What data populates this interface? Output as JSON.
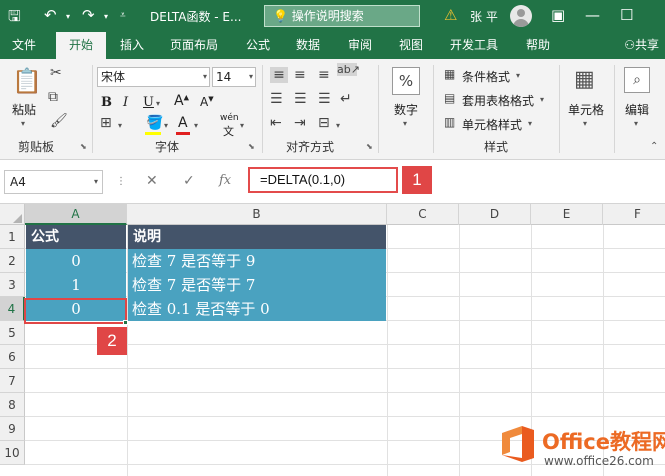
{
  "titlebar": {
    "doc_title": "DELTA函数 - E...",
    "tell_me": "操作说明搜索",
    "user_name": "张 平"
  },
  "tabs": [
    {
      "label": "文件",
      "active": false
    },
    {
      "label": "开始",
      "active": true
    },
    {
      "label": "插入",
      "active": false
    },
    {
      "label": "页面布局",
      "active": false
    },
    {
      "label": "公式",
      "active": false
    },
    {
      "label": "数据",
      "active": false
    },
    {
      "label": "审阅",
      "active": false
    },
    {
      "label": "视图",
      "active": false
    },
    {
      "label": "开发工具",
      "active": false
    },
    {
      "label": "帮助",
      "active": false
    }
  ],
  "share_label": "共享",
  "ribbon": {
    "clipboard": {
      "paste": "粘贴",
      "group": "剪贴板"
    },
    "font": {
      "name": "宋体",
      "size": "14",
      "phonetic": "wén",
      "group": "字体"
    },
    "alignment": {
      "group": "对齐方式"
    },
    "number": {
      "label": "数字",
      "icon_text": "%"
    },
    "styles": {
      "conditional": "条件格式",
      "table": "套用表格格式",
      "cell_styles": "单元格样式",
      "group": "样式"
    },
    "cells": {
      "label": "单元格"
    },
    "editing": {
      "label": "编辑"
    }
  },
  "formula_bar": {
    "name_box": "A4",
    "fx": "fx",
    "formula": "=DELTA(0.1,0)",
    "callout": "1"
  },
  "sheet": {
    "columns": [
      "A",
      "B",
      "C",
      "D",
      "E",
      "F"
    ],
    "selected_column": "A",
    "rows": [
      "1",
      "2",
      "3",
      "4",
      "5",
      "6",
      "7",
      "8",
      "9",
      "10"
    ],
    "selected_row": "4",
    "header": {
      "a": "公式",
      "b": "说明"
    },
    "data": [
      {
        "a": "0",
        "b": "检查 7 是否等于 9"
      },
      {
        "a": "1",
        "b": "检查 7 是否等于 7"
      },
      {
        "a": "0",
        "b": "检查 0.1 是否等于 0"
      }
    ],
    "callout": "2"
  },
  "watermark": {
    "name": "Office教程网",
    "url": "www.office26.com"
  },
  "colors": {
    "excel_green": "#217346",
    "header_fill": "#44546a",
    "data_fill": "#4aa2c0",
    "callout_red": "#e04646"
  }
}
